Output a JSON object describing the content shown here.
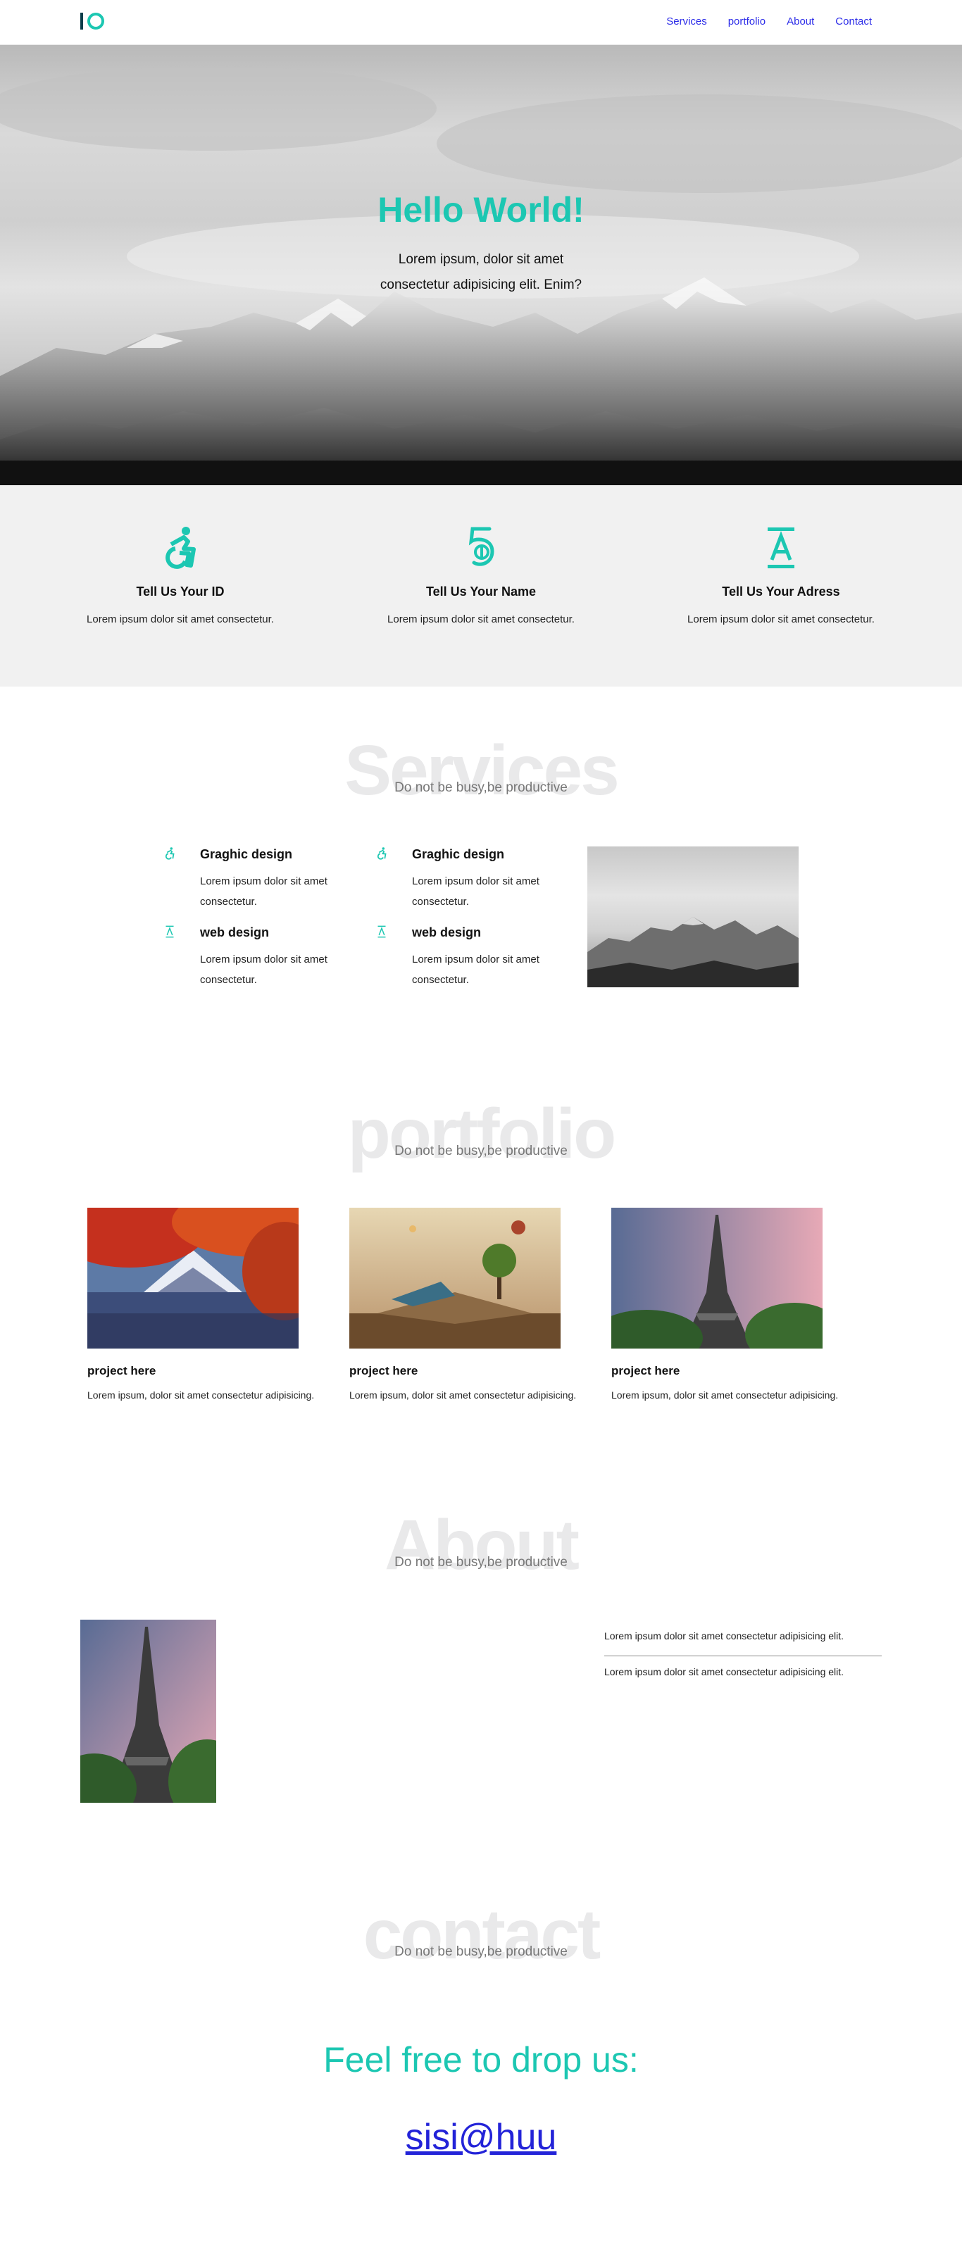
{
  "nav": {
    "links": [
      "Services",
      "portfolio",
      "About",
      "Contact"
    ]
  },
  "hero": {
    "title": "Hello World!",
    "text": "Lorem ipsum, dolor sit amet consectetur adipisicing elit. Enim?"
  },
  "features": [
    {
      "icon": "wheelchair-icon",
      "title": "Tell Us Your ID",
      "text": "Lorem ipsum dolor sit amet consectetur."
    },
    {
      "icon": "five-hundred-px-icon",
      "title": "Tell Us Your Name",
      "text": "Lorem ipsum dolor sit amet consectetur."
    },
    {
      "icon": "text-height-icon",
      "title": "Tell Us Your Adress",
      "text": "Lorem ipsum dolor sit amet consectetur."
    }
  ],
  "services": {
    "bg_title": "Services",
    "subtitle": "Do not be busy,be productive",
    "items": [
      {
        "icon": "wheelchair-icon",
        "title": "Graghic design",
        "text": "Lorem ipsum dolor sit amet consectetur."
      },
      {
        "icon": "wheelchair-icon",
        "title": "Graghic design",
        "text": "Lorem ipsum dolor sit amet consectetur."
      },
      {
        "icon": "text-height-icon",
        "title": "web design",
        "text": "Lorem ipsum dolor sit amet consectetur."
      },
      {
        "icon": "text-height-icon",
        "title": "web design",
        "text": "Lorem ipsum dolor sit amet consectetur."
      }
    ]
  },
  "portfolio": {
    "bg_title": "portfolio",
    "subtitle": "Do not be busy,be productive",
    "cards": [
      {
        "title": "project here",
        "text": "Lorem ipsum, dolor sit amet consectetur adipisicing."
      },
      {
        "title": "project here",
        "text": "Lorem ipsum, dolor sit amet consectetur adipisicing."
      },
      {
        "title": "project here",
        "text": "Lorem ipsum, dolor sit amet consectetur adipisicing."
      }
    ]
  },
  "about": {
    "bg_title": "About",
    "subtitle": "Do not be busy,be productive",
    "lines": [
      "Lorem ipsum dolor sit amet consectetur adipisicing elit.",
      "Lorem ipsum dolor sit amet consectetur adipisicing elit."
    ]
  },
  "contact": {
    "bg_title": "contact",
    "subtitle": "Do not be busy,be productive",
    "headline": "Feel free to drop us:",
    "email": "sisi@huu"
  },
  "colors": {
    "accent": "#1cc7b2",
    "link": "#2c2ce8"
  }
}
